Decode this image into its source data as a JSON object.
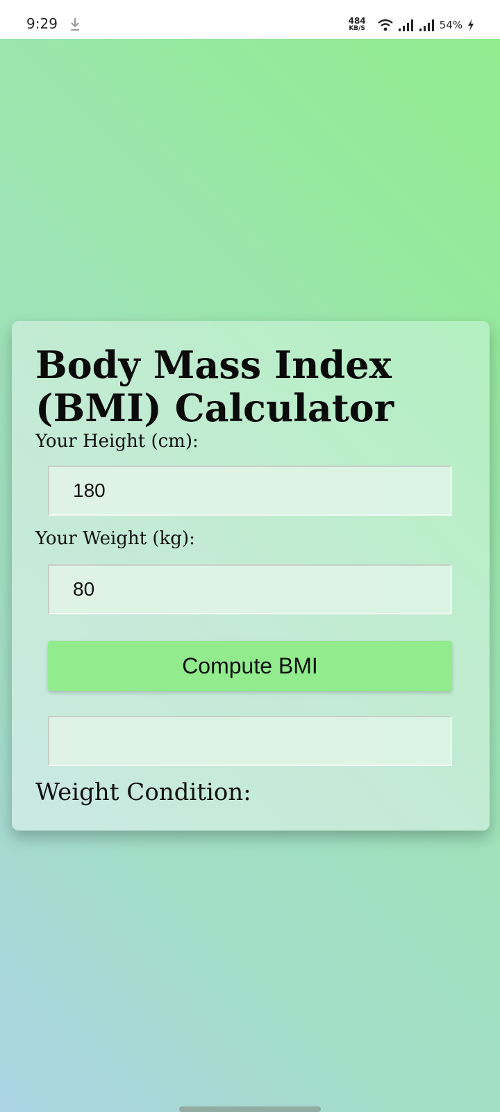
{
  "status_bar": {
    "time": "9:29",
    "net_speed_value": "484",
    "net_speed_unit": "KB/S",
    "battery": "54%",
    "icons": [
      "download-icon",
      "wifi-icon",
      "signal-icon",
      "signal-icon",
      "charging-icon"
    ]
  },
  "calculator": {
    "title": "Body Mass Index (BMI) Calculator",
    "height_label": "Your Height (cm):",
    "height_value": "180",
    "weight_label": "Your Weight (kg):",
    "weight_value": "80",
    "compute_label": "Compute BMI",
    "result_value": "",
    "condition_label": "Weight Condition:"
  },
  "colors": {
    "button": "#92ec8e",
    "background_top": "#90ec8c",
    "background_bottom": "#acd4e4"
  }
}
